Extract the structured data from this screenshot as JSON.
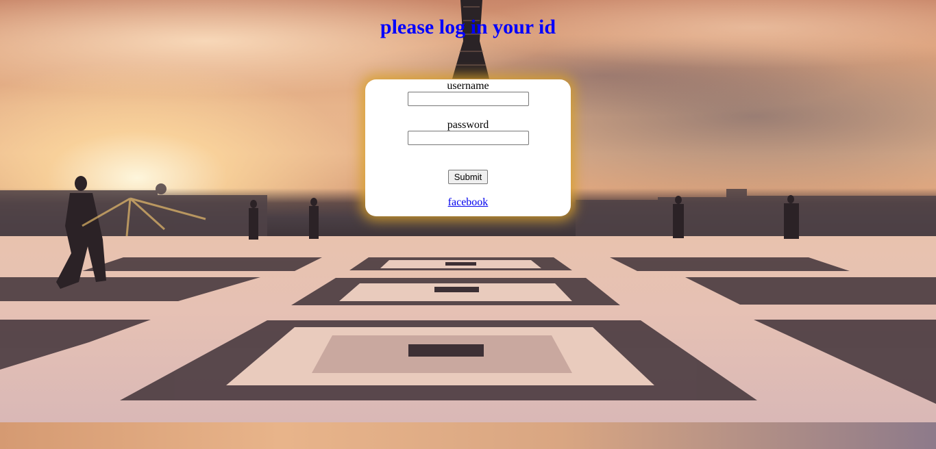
{
  "page": {
    "title": "please log in your id"
  },
  "login_form": {
    "username_label": "username",
    "username_value": "",
    "password_label": "password",
    "password_value": "",
    "submit_label": "Submit",
    "facebook_link": "facebook"
  },
  "colors": {
    "title": "#0000ff",
    "link": "#0000ee",
    "card_glow": "#d7a028"
  },
  "background": {
    "icon": "eiffel-tower-sunset-plaza-photo"
  }
}
